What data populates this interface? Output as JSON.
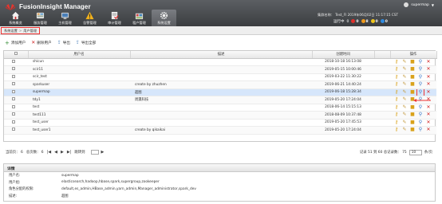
{
  "app": {
    "brand": "FusionInsight Manager",
    "user": "supermap",
    "cluster_info": "集群名称：  Test_FI    2019年06月02日 11:17:15 CST",
    "status": {
      "running_label": "运行中",
      "running_count": "0",
      "alerts": [
        {
          "color": "#e0302a",
          "count": "0"
        },
        {
          "color": "#f09a1b",
          "count": "8"
        },
        {
          "color": "#f0c51b",
          "count": "0"
        },
        {
          "color": "#2f8be0",
          "count": "0"
        }
      ]
    }
  },
  "nav": [
    {
      "label": "系统概览",
      "icon": "home-icon"
    },
    {
      "label": "服务管理",
      "icon": "services-icon"
    },
    {
      "label": "主机管理",
      "icon": "host-icon"
    },
    {
      "label": "告警管理",
      "icon": "alarm-icon"
    },
    {
      "label": "审计管理",
      "icon": "audit-icon"
    },
    {
      "label": "租户管理",
      "icon": "tenant-icon"
    },
    {
      "label": "系统设置",
      "icon": "settings-icon"
    }
  ],
  "breadcrumb": [
    "系统设置",
    "用户管理"
  ],
  "toolbar": {
    "add": "添加用户",
    "delete": "删除用户",
    "export": "导出",
    "export_all": "导出全部"
  },
  "table": {
    "headers": [
      "",
      "用户名",
      "描述",
      "创建时间",
      "",
      "操作"
    ],
    "rows": [
      {
        "name": "shicun",
        "desc": "",
        "created": "2018-10-18 16:13:08"
      },
      {
        "name": "scir11",
        "desc": "",
        "created": "2019-05-15 10:00:46"
      },
      {
        "name": "scir_test",
        "desc": "",
        "created": "2019-03-22 11:30:22"
      },
      {
        "name": "sparkuser",
        "desc": "create by zhuzhen",
        "created": "2019-06-21 14:40:24"
      },
      {
        "name": "supermap",
        "desc": "超图",
        "created": "2019-06-18 15:28:34"
      },
      {
        "name": "tdy1",
        "desc": "周瀛科技",
        "created": "2019-05-20 17:24:04"
      },
      {
        "name": "test",
        "desc": "",
        "created": "2018-06-14 15:15:13"
      },
      {
        "name": "test111",
        "desc": "",
        "created": "2018-08-09 10:37:48"
      },
      {
        "name": "test_user",
        "desc": "",
        "created": "2019-05-20 17:45:53"
      },
      {
        "name": "test_user1",
        "desc": "create by qikaikai",
        "created": "2019-05-20 17:24:04"
      }
    ],
    "selected_index": 4
  },
  "pager": {
    "current": "当前页：",
    "current_val": "6",
    "total": "总页数：",
    "total_val": "6",
    "jump": "跳转到",
    "records": "记录  51  到  60   总记录数：  75",
    "size": "10",
    "size_suffix": "条/页"
  },
  "detail": {
    "title": "详情",
    "rows": [
      {
        "k": "用户名:",
        "v": "supermap"
      },
      {
        "k": "用户组:",
        "v": "elasticsearch,hadoop,hbase,spark,supergroup,zookeeper"
      },
      {
        "k": "角色分配的权限:",
        "v": "default,es_admin,HBase_admin,yarn_admin,Manager_administrator,spark_dev"
      },
      {
        "k": "描述:",
        "v": "超图"
      }
    ]
  }
}
